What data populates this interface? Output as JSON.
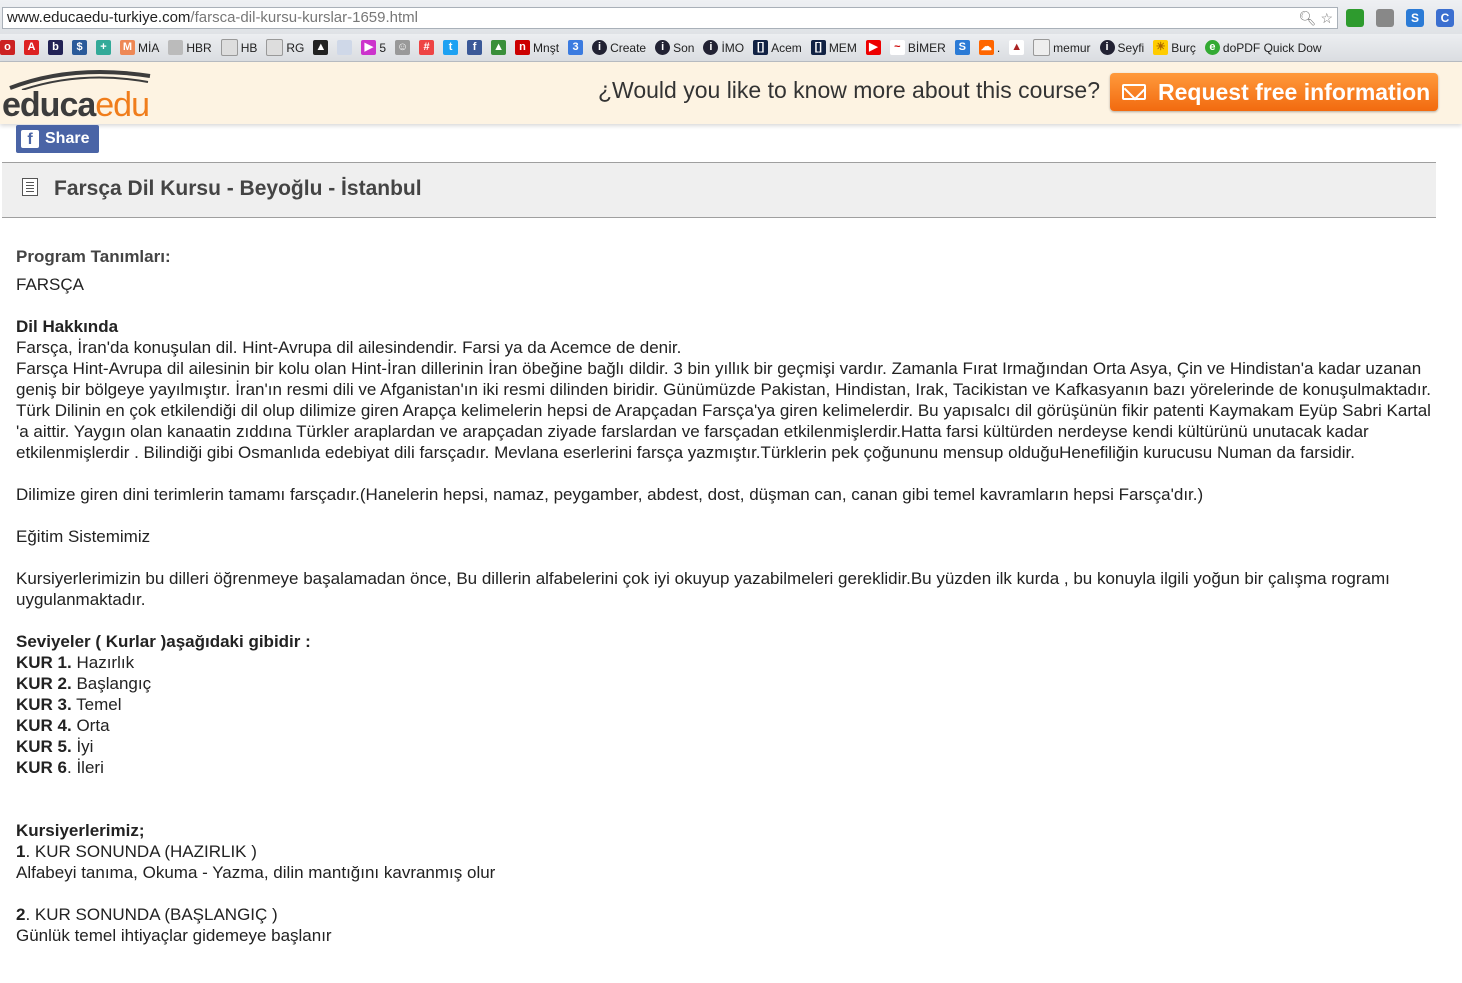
{
  "browser": {
    "url_host": "www.educaedu-turkiye.com",
    "url_path": "/farsca-dil-kursu-kurslar-1659.html",
    "bookmarks": [
      {
        "icon": "opera-icon",
        "label": ""
      },
      {
        "icon": "acrobat-icon",
        "label": ""
      },
      {
        "icon": "bing-icon",
        "label": ""
      },
      {
        "icon": "dollar-icon",
        "label": ""
      },
      {
        "icon": "plus-icon",
        "label": ""
      },
      {
        "icon": "mia-icon",
        "label": "MİA"
      },
      {
        "icon": "page-icon",
        "label": "HBR"
      },
      {
        "icon": "page-icon",
        "label": "HB"
      },
      {
        "icon": "page-icon",
        "label": "RG"
      },
      {
        "icon": "graduation-icon",
        "label": ""
      },
      {
        "icon": "page-icon",
        "label": ""
      },
      {
        "icon": "play-icon",
        "label": "5"
      },
      {
        "icon": "smile-icon",
        "label": ""
      },
      {
        "icon": "slack-icon",
        "label": ""
      },
      {
        "icon": "twitter-icon",
        "label": ""
      },
      {
        "icon": "facebook-icon",
        "label": ""
      },
      {
        "icon": "drive-icon",
        "label": ""
      },
      {
        "icon": "news-icon",
        "label": "Mnşt"
      },
      {
        "icon": "calendar-icon",
        "label": ""
      },
      {
        "icon": "globe-icon",
        "label": "Create"
      },
      {
        "icon": "globe-icon",
        "label": "Son"
      },
      {
        "icon": "globe-icon",
        "label": "İMO"
      },
      {
        "icon": "bracket-icon",
        "label": "Acem"
      },
      {
        "icon": "bracket-icon",
        "label": "MEM"
      },
      {
        "icon": "youtube-icon",
        "label": ""
      },
      {
        "icon": "bimer-icon",
        "label": "BİMER"
      },
      {
        "icon": "s-icon",
        "label": ""
      },
      {
        "icon": "cloud-icon",
        "label": "."
      },
      {
        "icon": "torch-icon",
        "label": ""
      },
      {
        "icon": "page-icon",
        "label": "memur"
      },
      {
        "icon": "globe-icon",
        "label": "Seyfi"
      },
      {
        "icon": "sun-icon",
        "label": "Burç"
      },
      {
        "icon": "globe-icon",
        "label": "doPDF Quick Dow"
      }
    ]
  },
  "header": {
    "logo_part1": "educa",
    "logo_part2": "edu",
    "question": "¿Would you like to know more about this course?",
    "request_button": "Request free information"
  },
  "share": {
    "label": "Share"
  },
  "page_title": "Farsça Dil Kursu - Beyoğlu - İstanbul",
  "content": {
    "program_heading": "Program Tanımları:",
    "program_name": "FARSÇA",
    "about_heading": "Dil Hakkında",
    "about_line1": "Farsça, İran'da konuşulan dil. Hint-Avrupa dil ailesindendir. Farsi ya da Acemce de denir.",
    "about_line2": "Farsça Hint-Avrupa dil ailesinin bir kolu olan Hint-İran dillerinin İran öbeğine bağlı dildir. 3 bin yıllık bir geçmişi vardır. Zamanla Fırat Irmağından Orta Asya, Çin ve Hindistan'a kadar uzanan geniş bir bölgeye yayılmıştır. İran'ın resmi dili ve Afganistan'ın iki resmi dilinden biridir. Günümüzde Pakistan, Hindistan, Irak, Tacikistan ve Kafkasyanın bazı yörelerinde de konuşulmaktadır. Türk Dilinin en çok etkilendiği dil olup dilimize giren Arapça kelimelerin hepsi de Arapçadan Farsça'ya giren kelimelerdir. Bu yapısalcı dil görüşünün fikir patenti Kaymakam Eyüp Sabri Kartal 'a aittir. Yaygın olan kanaatin zıddına Türkler araplardan ve arapçadan ziyade farslardan ve farsçadan etkilenmişlerdir.Hatta farsi kültürden nerdeyse kendi kültürünü unutacak kadar etkilenmişlerdir . Bilindiği gibi Osmanlıda edebiyat dili farsçadır. Mevlana eserlerini farsça yazmıştır.Türklerin pek çoğununu mensup olduğuHenefiliğin kurucusu Numan da farsidir.",
    "religious_terms": "Dilimize giren dini terimlerin tamamı farsçadır.(Hanelerin hepsi, namaz, peygamber, abdest, dost, düşman can, canan gibi temel kavramların hepsi Farsça'dır.)",
    "education_heading": "Eğitim Sistemimiz",
    "education_text": "Kursiyerlerimizin bu dilleri öğrenmeye başalamadan önce, Bu dillerin alfabelerini çok iyi okuyup yazabilmeleri gereklidir.Bu yüzden ilk kurda , bu konuyla ilgili yoğun bir çalışma rogramı uygulanmaktadır.",
    "levels_heading": "Seviyeler ( Kurlar )aşağıdaki gibidir :",
    "levels": [
      {
        "kur": "KUR 1.",
        "name": " Hazırlık"
      },
      {
        "kur": "KUR 2.",
        "name": " Başlangıç"
      },
      {
        "kur": "KUR 3.",
        "name": " Temel"
      },
      {
        "kur": "KUR 4.",
        "name": " Orta"
      },
      {
        "kur": "KUR 5.",
        "name": " İyi"
      },
      {
        "kur": "KUR 6",
        "name": ". İleri"
      }
    ],
    "students_heading": "Kursiyerlerimiz;",
    "outcomes": [
      {
        "num": "1",
        "title": ". KUR SONUNDA (HAZIRLIK )",
        "desc": "Alfabeyi tanıma, Okuma - Yazma, dilin mantığını kavranmış olur"
      },
      {
        "num": "2",
        "title": ". KUR SONUNDA (BAŞLANGIÇ )",
        "desc": "Günlük temel ihtiyaçlar gidemeye başlanır"
      }
    ]
  }
}
